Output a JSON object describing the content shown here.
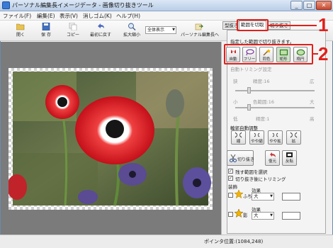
{
  "window": {
    "title": "パーソナル編集長イメージデータ - 画像切り抜きツール",
    "min": "_",
    "max": "□",
    "close": "✕"
  },
  "menu": [
    "ファイル(F)",
    "編集(E)",
    "表示(V)",
    "消しゴム(K)",
    "ヘルプ(H)"
  ],
  "toolbar": {
    "open": "開く",
    "save": "保 存",
    "copy": "コピー",
    "undo": "最初に戻す",
    "zoom": "拡大縮小",
    "view_value": "全体表示",
    "export": "パーソナル編集長へ"
  },
  "panel": {
    "tabs": [
      "型抜き",
      "範囲を切取",
      "切り抜き"
    ],
    "instruction": "指定した範囲で切り抜きます。",
    "shapes": [
      "自動",
      "フリー",
      "同色",
      "矩形",
      "楕円"
    ],
    "auto_trim_label": "自動トリミング設定",
    "slider1": {
      "left": "狭",
      "center": "精度:16",
      "right": "広"
    },
    "slider2": {
      "left": "小",
      "center": "色範囲:16",
      "right": "大"
    },
    "slider3": {
      "left": "低",
      "center": "精度:1",
      "right": "高"
    },
    "contour_label": "輪郭自動調整",
    "contour": [
      "縮",
      "やや縮",
      "やや拡",
      "拡"
    ],
    "actions": [
      "切り抜き",
      "復元",
      "反転"
    ],
    "checkbox1": "残す範囲を選択",
    "checkbox2": "切り抜き後にトリミング",
    "decoration_label": "装飾",
    "deco1": {
      "name": "ふち",
      "effect_label": "効果",
      "effect_value": "大"
    },
    "deco2": {
      "name": "影",
      "effect_label": "効果",
      "effect_value": "大"
    }
  },
  "status": {
    "text": "ポインタ位置:(1084,248)"
  },
  "callouts": [
    "1",
    "2"
  ],
  "colors": {
    "accent_red": "#e0201b",
    "anemone_red": "#d8151c",
    "anemone_purple": "#5a4b93"
  }
}
